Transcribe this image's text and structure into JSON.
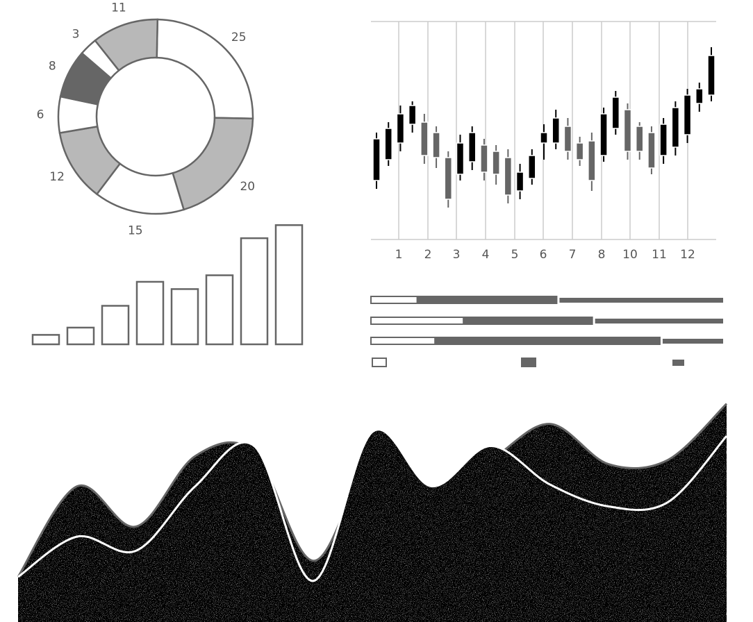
{
  "colors": {
    "outline": "#666666",
    "light_gray": "#b8b8b8",
    "dark_gray": "#666666",
    "black": "#000000",
    "white": "#ffffff",
    "grid": "#cccccc"
  },
  "chart_data": [
    {
      "type": "donut",
      "segments": [
        {
          "label": "25",
          "value": 25,
          "fill": "white"
        },
        {
          "label": "20",
          "value": 20,
          "fill": "light_gray"
        },
        {
          "label": "15",
          "value": 15,
          "fill": "white"
        },
        {
          "label": "12",
          "value": 12,
          "fill": "light_gray"
        },
        {
          "label": "6",
          "value": 6,
          "fill": "white"
        },
        {
          "label": "8",
          "value": 8,
          "fill": "dark_gray"
        },
        {
          "label": "3",
          "value": 3,
          "fill": "white"
        },
        {
          "label": "11",
          "value": 11,
          "fill": "light_gray"
        }
      ]
    },
    {
      "type": "bar",
      "values": [
        1.3,
        2.3,
        5.3,
        8.6,
        7.6,
        9.5,
        14.6,
        16.4
      ],
      "ylim": [
        0,
        17
      ]
    },
    {
      "type": "candlestick",
      "x_tick_labels": [
        "1",
        "2",
        "3",
        "4",
        "5",
        "6",
        "7",
        "8",
        "10",
        "11",
        "12"
      ],
      "ylim": [
        0,
        100
      ],
      "candles": [
        {
          "open": 20,
          "close": 40,
          "low": 16,
          "high": 43,
          "color": "black"
        },
        {
          "open": 30,
          "close": 45,
          "low": 27,
          "high": 48,
          "color": "black"
        },
        {
          "open": 38,
          "close": 52,
          "low": 34,
          "high": 56,
          "color": "black"
        },
        {
          "open": 47,
          "close": 56,
          "low": 43,
          "high": 58,
          "color": "black"
        },
        {
          "open": 48,
          "close": 32,
          "low": 28,
          "high": 52,
          "color": "gray"
        },
        {
          "open": 43,
          "close": 31,
          "low": 26,
          "high": 46,
          "color": "gray"
        },
        {
          "open": 31,
          "close": 11,
          "low": 7,
          "high": 34,
          "color": "gray"
        },
        {
          "open": 23,
          "close": 38,
          "low": 20,
          "high": 42,
          "color": "black"
        },
        {
          "open": 29,
          "close": 43,
          "low": 25,
          "high": 46,
          "color": "black"
        },
        {
          "open": 37,
          "close": 24,
          "low": 20,
          "high": 40,
          "color": "gray"
        },
        {
          "open": 34,
          "close": 23,
          "low": 18,
          "high": 37,
          "color": "gray"
        },
        {
          "open": 31,
          "close": 13,
          "low": 9,
          "high": 35,
          "color": "gray"
        },
        {
          "open": 15,
          "close": 24,
          "low": 11,
          "high": 28,
          "color": "black"
        },
        {
          "open": 21,
          "close": 32,
          "low": 18,
          "high": 35,
          "color": "black"
        },
        {
          "open": 38,
          "close": 43,
          "low": 30,
          "high": 47,
          "color": "black"
        },
        {
          "open": 38,
          "close": 50,
          "low": 35,
          "high": 54,
          "color": "black"
        },
        {
          "open": 46,
          "close": 34,
          "low": 30,
          "high": 50,
          "color": "gray"
        },
        {
          "open": 38,
          "close": 30,
          "low": 27,
          "high": 41,
          "color": "gray"
        },
        {
          "open": 39,
          "close": 20,
          "low": 15,
          "high": 43,
          "color": "gray"
        },
        {
          "open": 32,
          "close": 52,
          "low": 29,
          "high": 55,
          "color": "black"
        },
        {
          "open": 45,
          "close": 60,
          "low": 42,
          "high": 63,
          "color": "black"
        },
        {
          "open": 54,
          "close": 34,
          "low": 30,
          "high": 57,
          "color": "gray"
        },
        {
          "open": 46,
          "close": 34,
          "low": 30,
          "high": 48,
          "color": "gray"
        },
        {
          "open": 43,
          "close": 26,
          "low": 23,
          "high": 46,
          "color": "gray"
        },
        {
          "open": 32,
          "close": 47,
          "low": 28,
          "high": 50,
          "color": "black"
        },
        {
          "open": 36,
          "close": 55,
          "low": 32,
          "high": 58,
          "color": "black"
        },
        {
          "open": 42,
          "close": 61,
          "low": 38,
          "high": 64,
          "color": "black"
        },
        {
          "open": 57,
          "close": 64,
          "low": 53,
          "high": 67,
          "color": "black"
        },
        {
          "open": 61,
          "close": 80,
          "low": 58,
          "high": 84,
          "color": "black"
        }
      ]
    },
    {
      "type": "bar_horizontal_stacked",
      "xlim": [
        0,
        100
      ],
      "rows": [
        {
          "white": 13,
          "dark": 40,
          "dark_thin": 46
        },
        {
          "white": 26,
          "dark": 37,
          "dark_thin": 36
        },
        {
          "white": 18,
          "dark": 64,
          "dark_thin": 17
        }
      ],
      "legend": [
        "white",
        "dark",
        "dark_thin"
      ]
    },
    {
      "type": "area",
      "layers": [
        {
          "name_fill": "black",
          "outline": "gray",
          "y": [
            10,
            55,
            35,
            70,
            72,
            18,
            68,
            52,
            68,
            86,
            66,
            68,
            96
          ]
        },
        {
          "name_fill": "black",
          "outline": "white",
          "y": [
            10,
            30,
            23,
            55,
            75,
            8,
            82,
            55,
            75,
            56,
            45,
            47,
            80
          ]
        }
      ],
      "ylim": [
        0,
        100
      ]
    }
  ]
}
